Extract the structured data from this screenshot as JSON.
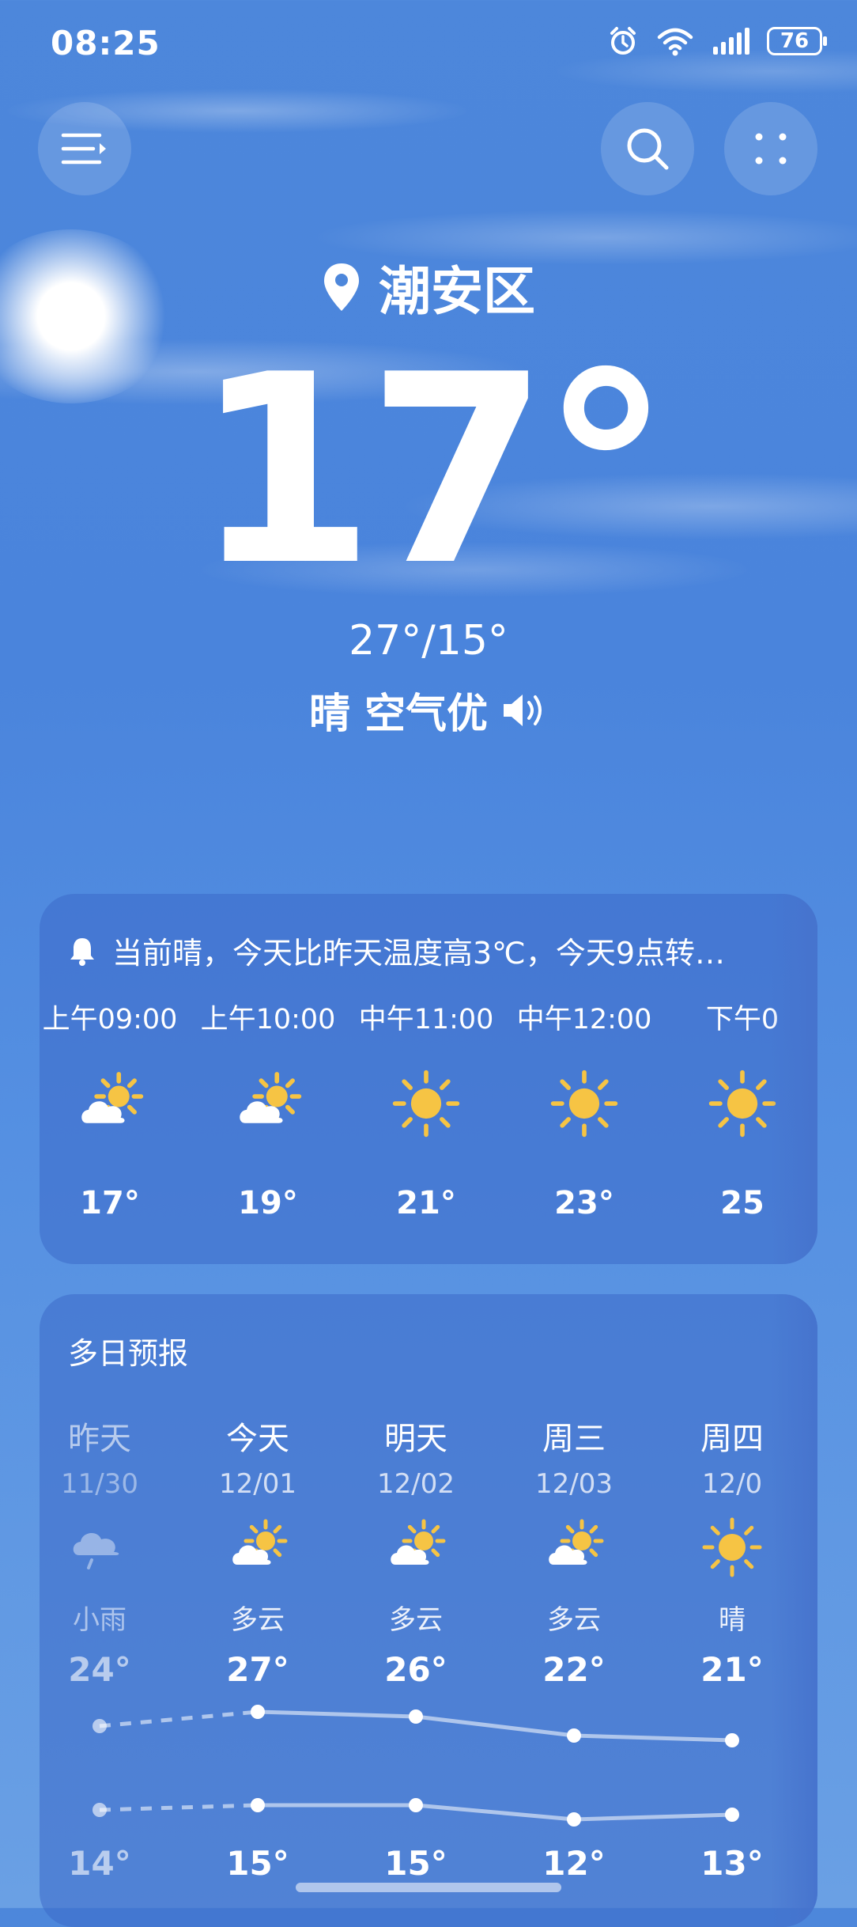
{
  "status_bar": {
    "time": "08:25",
    "battery": "76"
  },
  "location": "潮安区",
  "current": {
    "temp": "17°",
    "range": "27°/15°",
    "condition": "晴 空气优"
  },
  "alert": "当前晴，今天比昨天温度高3℃，今天9点转…",
  "hourly": [
    {
      "label": "上午09:00",
      "icon": "partly-cloudy-icon",
      "temp": "17°"
    },
    {
      "label": "上午10:00",
      "icon": "partly-cloudy-icon",
      "temp": "19°"
    },
    {
      "label": "中午11:00",
      "icon": "sun-icon",
      "temp": "21°"
    },
    {
      "label": "中午12:00",
      "icon": "sun-icon",
      "temp": "23°"
    },
    {
      "label": "下午0",
      "icon": "sun-icon",
      "temp": "25"
    }
  ],
  "forecast": {
    "title": "多日预报",
    "days": [
      {
        "name": "昨天",
        "date": "11/30",
        "weather": "小雨",
        "icon": "rain-cloud-icon",
        "high": "24°",
        "low": "14°"
      },
      {
        "name": "今天",
        "date": "12/01",
        "weather": "多云",
        "icon": "partly-cloudy-icon",
        "high": "27°",
        "low": "15°"
      },
      {
        "name": "明天",
        "date": "12/02",
        "weather": "多云",
        "icon": "partly-cloudy-icon",
        "high": "26°",
        "low": "15°"
      },
      {
        "name": "周三",
        "date": "12/03",
        "weather": "多云",
        "icon": "partly-cloudy-icon",
        "high": "22°",
        "low": "12°"
      },
      {
        "name": "周四",
        "date": "12/0",
        "weather": "晴",
        "icon": "sun-icon",
        "high": "21°",
        "low": "13°"
      }
    ]
  },
  "colors": {
    "sun": "#f6c444",
    "background": "#4d87db"
  }
}
